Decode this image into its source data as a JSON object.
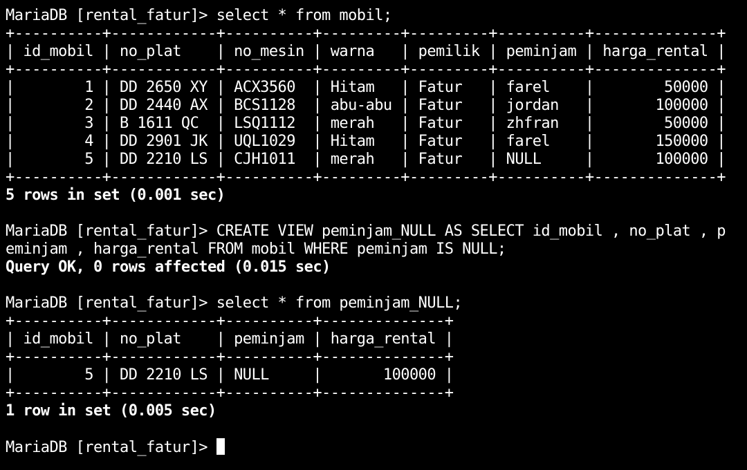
{
  "terminal": {
    "prompt": "MariaDB [rental_fatur]> ",
    "commands": {
      "select_mobil": "select * from mobil;",
      "create_view_1": "CREATE VIEW peminjam_NULL AS SELECT id_mobil , no_plat , p",
      "create_view_2": "eminjam , harga_rental FROM mobil WHERE peminjam IS NULL;",
      "select_view": "select * from peminjam_NULL;"
    },
    "mobil_table": {
      "border": "+----------+------------+----------+---------+---------+----------+--------------+",
      "header": "| id_mobil | no_plat    | no_mesin | warna   | pemilik | peminjam | harga_rental |",
      "rows": [
        "|        1 | DD 2650 XY | ACX3560  | Hitam   | Fatur   | farel    |        50000 |",
        "|        2 | DD 2440 AX | BCS1128  | abu-abu | Fatur   | jordan   |       100000 |",
        "|        3 | B 1611 QC  | LSQ1112  | merah   | Fatur   | zhfran   |        50000 |",
        "|        4 | DD 2901 JK | UQL1029  | Hitam   | Fatur   | farel    |       150000 |",
        "|        5 | DD 2210 LS | CJH1011  | merah   | Fatur   | NULL     |       100000 |"
      ]
    },
    "result_mobil": "5 rows in set (0.001 sec)",
    "result_create": "Query OK, 0 rows affected (0.015 sec)",
    "view_table": {
      "border": "+----------+------------+----------+--------------+",
      "header": "| id_mobil | no_plat    | peminjam | harga_rental |",
      "rows": [
        "|        5 | DD 2210 LS | NULL     |       100000 |"
      ]
    },
    "result_view": "1 row in set (0.005 sec)"
  }
}
